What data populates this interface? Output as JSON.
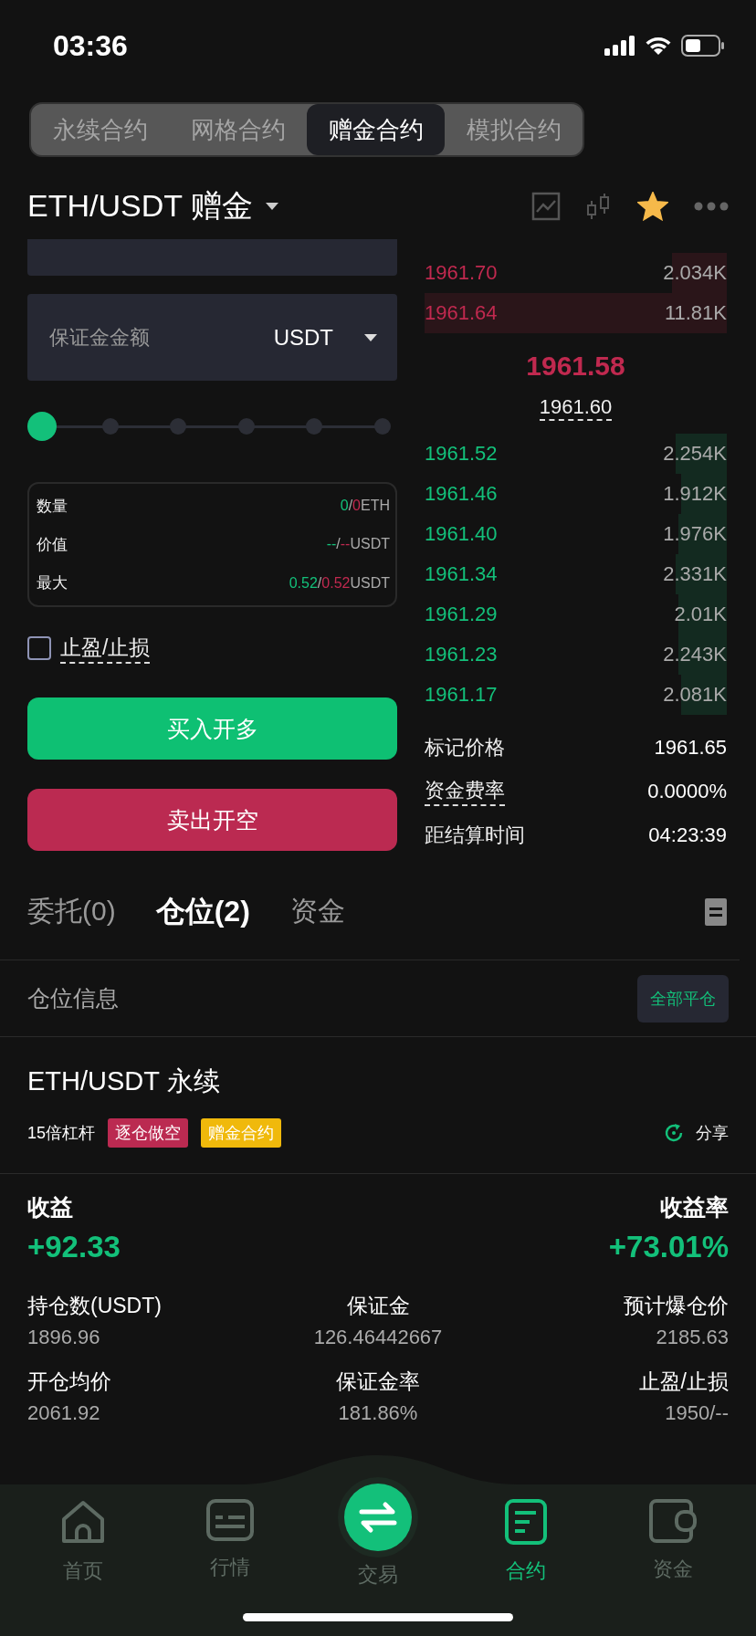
{
  "status_bar": {
    "time": "03:36"
  },
  "contract_tabs": [
    {
      "label": "永续合约",
      "selected": false
    },
    {
      "label": "网格合约",
      "selected": false
    },
    {
      "label": "赠金合约",
      "selected": true
    },
    {
      "label": "模拟合约",
      "selected": false
    }
  ],
  "pair": {
    "title": "ETH/USDT 赠金",
    "favorite": true
  },
  "order_form": {
    "margin_field": {
      "placeholder": "保证金金额",
      "unit": "USDT"
    },
    "slider": {
      "level": 0
    },
    "summary": [
      {
        "label": "数量",
        "parts": [
          {
            "text": "0",
            "kind": "long"
          },
          {
            "text": "/",
            "kind": "plain"
          },
          {
            "text": "0",
            "kind": "short"
          },
          {
            "text": "ETH",
            "kind": "unit"
          }
        ]
      },
      {
        "label": "价值",
        "parts": [
          {
            "text": "--",
            "kind": "long"
          },
          {
            "text": "/",
            "kind": "plain"
          },
          {
            "text": "--",
            "kind": "short"
          },
          {
            "text": "USDT",
            "kind": "unit"
          }
        ]
      },
      {
        "label": "最大",
        "parts": [
          {
            "text": "0.52",
            "kind": "long"
          },
          {
            "text": "/",
            "kind": "plain"
          },
          {
            "text": "0.52",
            "kind": "short"
          },
          {
            "text": "USDT",
            "kind": "unit"
          }
        ]
      }
    ],
    "tp_sl": {
      "label": "止盈/止损",
      "checked": false
    },
    "buy_button": "买入开多",
    "sell_button": "卖出开空"
  },
  "order_book": {
    "asks": [
      {
        "price": "1961.70",
        "amount": "2.034K",
        "level": 0.18
      },
      {
        "price": "1961.64",
        "amount": "11.81K",
        "level": 1
      }
    ],
    "last_price": "1961.58",
    "mark_price_link": "1961.60",
    "bids": [
      {
        "price": "1961.52",
        "amount": "2.254K",
        "level": 0.17
      },
      {
        "price": "1961.46",
        "amount": "1.912K",
        "level": 0.15
      },
      {
        "price": "1961.40",
        "amount": "1.976K",
        "level": 0.16
      },
      {
        "price": "1961.34",
        "amount": "2.331K",
        "level": 0.17
      },
      {
        "price": "1961.29",
        "amount": "2.01K",
        "level": 0.16
      },
      {
        "price": "1961.23",
        "amount": "2.243K",
        "level": 0.16
      },
      {
        "price": "1961.17",
        "amount": "2.081K",
        "level": 0.15
      }
    ],
    "info": [
      {
        "label": "标记价格",
        "value": "1961.65",
        "underlined": false
      },
      {
        "label": "资金费率",
        "value": "0.0000%",
        "underlined": true
      },
      {
        "label": "距结算时间",
        "value": "04:23:39",
        "underlined": false
      }
    ]
  },
  "bottom_tabs": [
    {
      "label": "委托(0)",
      "selected": false
    },
    {
      "label": "仓位(2)",
      "selected": true
    },
    {
      "label": "资金",
      "selected": false
    }
  ],
  "positions_header": {
    "title": "仓位信息",
    "close_all_button": "全部平仓"
  },
  "position": {
    "title": "ETH/USDT 永续",
    "leverage": "15倍杠杆",
    "tags": [
      {
        "text": "逐仓做空",
        "kind": "short"
      },
      {
        "text": "赠金合约",
        "kind": "bonus"
      }
    ],
    "share_button": "分享",
    "pnl": {
      "label": "收益",
      "value": "+92.33"
    },
    "pnl_rate": {
      "label": "收益率",
      "value": "+73.01%"
    },
    "stats": [
      {
        "label": "持仓数(USDT)",
        "value": "1896.96"
      },
      {
        "label": "保证金",
        "value": "126.46442667"
      },
      {
        "label": "预计爆仓价",
        "value": "2185.63"
      },
      {
        "label": "开仓均价",
        "value": "2061.92"
      },
      {
        "label": "保证金率",
        "value": "181.86%"
      },
      {
        "label": "止盈/止损",
        "value": "1950/--"
      }
    ]
  },
  "nav": [
    {
      "label": "首页",
      "kind": "home",
      "selected": false
    },
    {
      "label": "行情",
      "kind": "market",
      "selected": false
    },
    {
      "label": "交易",
      "kind": "trade",
      "selected": false
    },
    {
      "label": "合约",
      "kind": "contract",
      "selected": true
    },
    {
      "label": "资金",
      "kind": "wallet",
      "selected": false
    }
  ]
}
